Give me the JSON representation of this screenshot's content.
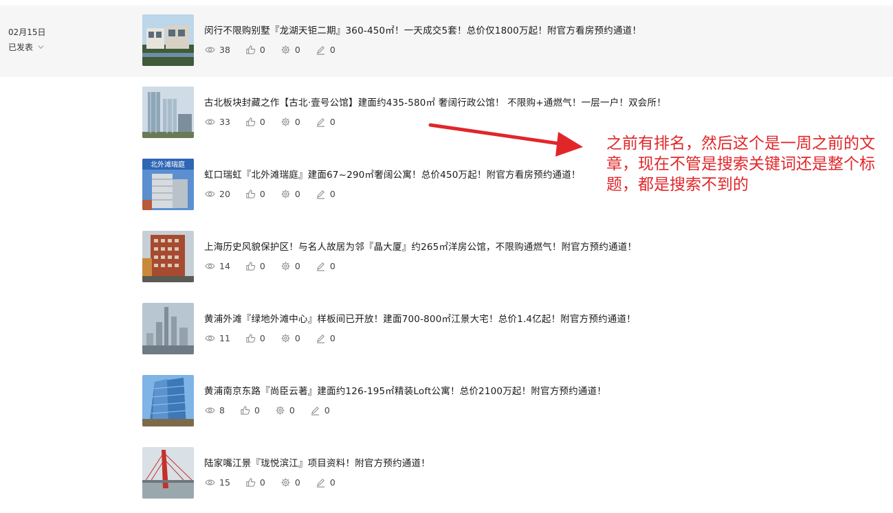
{
  "group": {
    "date": "02月15日",
    "status": "已发表"
  },
  "articles": [
    {
      "title": "闵行不限购别墅『龙湖天钜二期』360-450㎡！一天成交5套！总价仅1800万起！附官方看房预约通道！",
      "views": "38",
      "likes": "0",
      "shares": "0",
      "edits": "0"
    },
    {
      "title": "古北板块封藏之作【古北·壹号公馆】建面约435-580㎡ 奢阔行政公馆！ 不限购+通燃气！一层一户！双会所！",
      "views": "33",
      "likes": "0",
      "shares": "0",
      "edits": "0"
    },
    {
      "title": "虹口瑞虹『北外滩瑞庭』建面67~290㎡奢阔公寓！总价450万起！附官方看房预约通道！",
      "views": "20",
      "likes": "0",
      "shares": "0",
      "edits": "0",
      "thumb_text": "北外滩瑞庭"
    },
    {
      "title": "上海历史风貌保护区！与名人故居为邻『晶大厦』约265㎡洋房公馆，不限购通燃气！附官方预约通道！",
      "views": "14",
      "likes": "0",
      "shares": "0",
      "edits": "0"
    },
    {
      "title": "黄浦外滩『绿地外滩中心』样板间已开放！建面700-800㎡江景大宅！总价1.4亿起！附官方预约通道！",
      "views": "11",
      "likes": "0",
      "shares": "0",
      "edits": "0"
    },
    {
      "title": "黄浦南京东路『尚臣云著』建面约126-195㎡精装Loft公寓！总价2100万起！附官方预约通道！",
      "views": "8",
      "likes": "0",
      "shares": "0",
      "edits": "0"
    },
    {
      "title": "陆家嘴江景『珑悦滨江』项目资料！附官方预约通道！",
      "views": "15",
      "likes": "0",
      "shares": "0",
      "edits": "0"
    }
  ],
  "annotation": {
    "text": "之前有排名，然后这个是一周之前的文章，现在不管是搜索关键词还是整个标题，都是搜索不到的",
    "color": "#e1262a"
  },
  "icons": {
    "views": "eye-icon",
    "likes": "thumbs-up-icon",
    "shares": "gear-icon",
    "edits": "pencil-icon",
    "status": "chevron-down-icon"
  }
}
